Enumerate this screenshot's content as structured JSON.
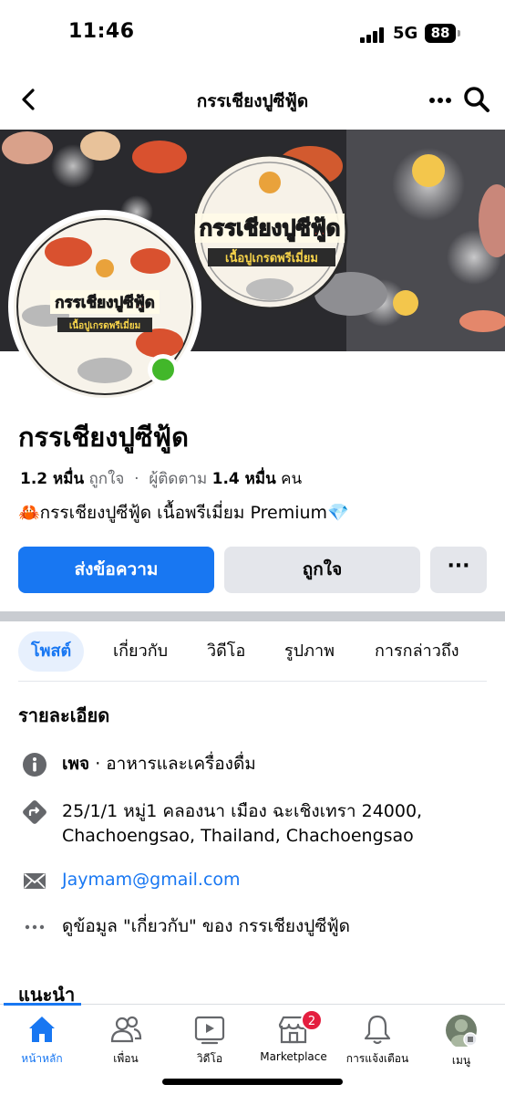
{
  "status_bar": {
    "time": "11:46",
    "network": "5G",
    "battery": "88"
  },
  "nav": {
    "title": "กรรเชียงปูซีฟู้ด"
  },
  "cover": {
    "title": "กรรเชียงปูซีฟู้ด",
    "subtitle": "เนื้อปูเกรดพรีเมี่ยม"
  },
  "page": {
    "name": "กรรเชียงปูซีฟู้ด",
    "likes_count": "1.2 หมื่น",
    "likes_label": "ถูกใจ",
    "separator": "·",
    "followers_label": "ผู้ติดตาม",
    "followers_count": "1.4 หมื่น",
    "followers_unit": "คน",
    "tagline": "🦀กรรเชียงปูซีฟู้ด เนื้อพรีเมี่ยม Premium💎"
  },
  "actions": {
    "message": "ส่งข้อความ",
    "like": "ถูกใจ",
    "more": "···"
  },
  "tabs": [
    {
      "label": "โพสต์",
      "active": true
    },
    {
      "label": "เกี่ยวกับ",
      "active": false
    },
    {
      "label": "วิดีโอ",
      "active": false
    },
    {
      "label": "รูปภาพ",
      "active": false
    },
    {
      "label": "การกล่าวถึง",
      "active": false
    }
  ],
  "details": {
    "title": "รายละเอียด",
    "category_prefix": "เพจ",
    "category": " · อาหารและเครื่องดื่ม",
    "address_line1": "25/1/1 หมู่1 คลองนา เมือง ฉะเชิงเทรา 24000,",
    "address_line2": "Chachoengsao, Thailand, Chachoengsao",
    "email": "Jaymam@gmail.com",
    "about_link": "ดูข้อมูล \"เกี่ยวกับ\" ของ กรรเชียงปูซีฟู้ด"
  },
  "recommend": "แนะนำ",
  "bottom_nav": [
    {
      "label": "หน้าหลัก",
      "icon": "home-icon",
      "active": true
    },
    {
      "label": "เพื่อน",
      "icon": "friends-icon",
      "active": false
    },
    {
      "label": "วิดีโอ",
      "icon": "video-icon",
      "active": false
    },
    {
      "label": "Marketplace",
      "icon": "marketplace-icon",
      "active": false,
      "badge": "2"
    },
    {
      "label": "การแจ้งเตือน",
      "icon": "bell-icon",
      "active": false
    },
    {
      "label": "เมนู",
      "icon": "profile-menu-icon",
      "active": false
    }
  ],
  "colors": {
    "accent": "#1877f2",
    "online": "#42b72a",
    "badge": "#e41e3f",
    "button_grey": "#e4e6eb"
  }
}
